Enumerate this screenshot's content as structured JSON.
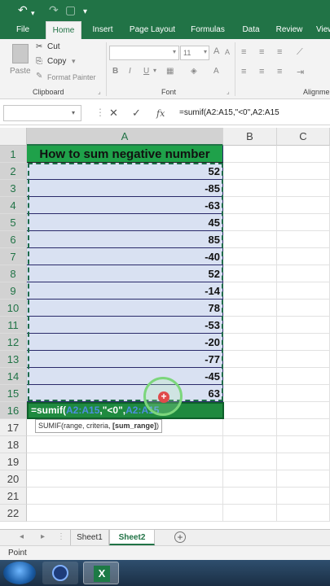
{
  "quick_access": {
    "undo": "↶",
    "redo": "↷",
    "save": "▢",
    "customize": "▾"
  },
  "tabs": [
    "File",
    "Home",
    "Insert",
    "Page Layout",
    "Formulas",
    "Data",
    "Review",
    "View"
  ],
  "active_tab": "Home",
  "ribbon": {
    "clipboard": {
      "paste_label": "Paste",
      "cut_label": "Cut",
      "copy_label": "Copy",
      "format_painter_label": "Format Painter",
      "group_label": "Clipboard"
    },
    "font": {
      "font_name": "",
      "font_size": "11",
      "bold": "B",
      "italic": "I",
      "underline": "U",
      "group_label": "Font"
    },
    "alignment": {
      "group_label": "Alignme"
    }
  },
  "formula_bar": {
    "cancel_icon": "✕",
    "enter_icon": "✓",
    "fx_label": "fx",
    "formula": "=sumif(A2:A15,\"<0\",A2:A15"
  },
  "columns": [
    "A",
    "B",
    "C"
  ],
  "rows": [
    "1",
    "2",
    "3",
    "4",
    "5",
    "6",
    "7",
    "8",
    "9",
    "10",
    "11",
    "12",
    "13",
    "14",
    "15",
    "16",
    "17",
    "18",
    "19",
    "20",
    "21",
    "22"
  ],
  "cells": {
    "A1": "How to sum negative number",
    "values": [
      "52",
      "-85",
      "-63",
      "45",
      "85",
      "-40",
      "52",
      "-14",
      "78",
      "-53",
      "-20",
      "-77",
      "-45",
      "63"
    ],
    "A16_edit": {
      "prefix": "=sumif(",
      "ref1": "A2:A15",
      "middle": ",\"<0\",",
      "ref2": "A2:A15"
    }
  },
  "tooltip": {
    "prefix": "SUMIF(range, criteria, ",
    "bold": "[sum_range]",
    "suffix": ")"
  },
  "sheets": [
    "Sheet1",
    "Sheet2"
  ],
  "active_sheet": "Sheet2",
  "status": "Point",
  "colors": {
    "excel_green": "#217346",
    "header_fill": "#1fa14a",
    "data_fill": "#d9e1f2",
    "ref_blue": "#4d8fe0"
  }
}
